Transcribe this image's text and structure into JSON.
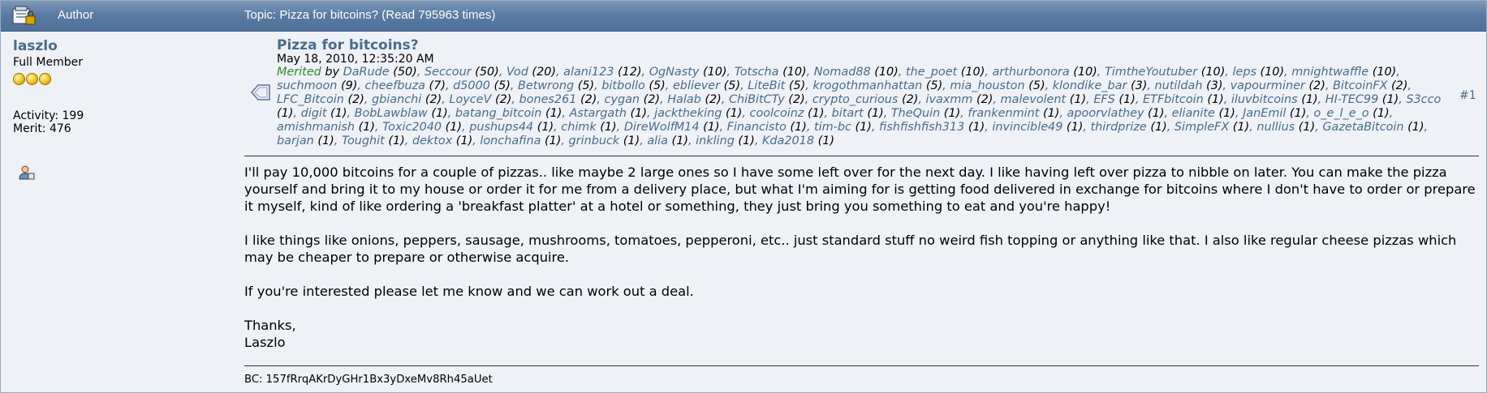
{
  "header": {
    "author_label": "Author",
    "topic_label": "Topic: Pizza for bitcoins?  (Read 795963 times)"
  },
  "poster": {
    "name": "laszlo",
    "rank": "Full Member",
    "star_count": 3,
    "activity": "Activity: 199",
    "merit": "Merit: 476"
  },
  "post": {
    "title": "Pizza for bitcoins?",
    "date": "May 18, 2010, 12:35:20 AM",
    "number": "#1",
    "merited_label": "Merited",
    "by_label": "by",
    "merits": [
      {
        "user": "DaRude",
        "count": "50"
      },
      {
        "user": "Seccour",
        "count": "50"
      },
      {
        "user": "Vod",
        "count": "20"
      },
      {
        "user": "alani123",
        "count": "12"
      },
      {
        "user": "OgNasty",
        "count": "10"
      },
      {
        "user": "Totscha",
        "count": "10"
      },
      {
        "user": "Nomad88",
        "count": "10"
      },
      {
        "user": "the_poet",
        "count": "10"
      },
      {
        "user": "arthurbonora",
        "count": "10"
      },
      {
        "user": "TimtheYoutuber",
        "count": "10"
      },
      {
        "user": "leps",
        "count": "10"
      },
      {
        "user": "mnightwaffle",
        "count": "10"
      },
      {
        "user": "suchmoon",
        "count": "9"
      },
      {
        "user": "cheefbuza",
        "count": "7"
      },
      {
        "user": "d5000",
        "count": "5"
      },
      {
        "user": "Betwrong",
        "count": "5"
      },
      {
        "user": "bitbollo",
        "count": "5"
      },
      {
        "user": "ebliever",
        "count": "5"
      },
      {
        "user": "LiteBit",
        "count": "5"
      },
      {
        "user": "krogothmanhattan",
        "count": "5"
      },
      {
        "user": "mia_houston",
        "count": "5"
      },
      {
        "user": "klondike_bar",
        "count": "3"
      },
      {
        "user": "nutildah",
        "count": "3"
      },
      {
        "user": "vapourminer",
        "count": "2"
      },
      {
        "user": "BitcoinFX",
        "count": "2"
      },
      {
        "user": "LFC_Bitcoin",
        "count": "2"
      },
      {
        "user": "gbianchi",
        "count": "2"
      },
      {
        "user": "LoyceV",
        "count": "2"
      },
      {
        "user": "bones261",
        "count": "2"
      },
      {
        "user": "cygan",
        "count": "2"
      },
      {
        "user": "Halab",
        "count": "2"
      },
      {
        "user": "ChiBitCTy",
        "count": "2"
      },
      {
        "user": "crypto_curious",
        "count": "2"
      },
      {
        "user": "ivaxmm",
        "count": "2"
      },
      {
        "user": "malevolent",
        "count": "1"
      },
      {
        "user": "EFS",
        "count": "1"
      },
      {
        "user": "ETFbitcoin",
        "count": "1"
      },
      {
        "user": "iluvbitcoins",
        "count": "1"
      },
      {
        "user": "HI-TEC99",
        "count": "1"
      },
      {
        "user": "S3cco",
        "count": "1"
      },
      {
        "user": "digit",
        "count": "1"
      },
      {
        "user": "BobLawblaw",
        "count": "1"
      },
      {
        "user": "batang_bitcoin",
        "count": "1"
      },
      {
        "user": "Astargath",
        "count": "1"
      },
      {
        "user": "jacktheking",
        "count": "1"
      },
      {
        "user": "coolcoinz",
        "count": "1"
      },
      {
        "user": "bitart",
        "count": "1"
      },
      {
        "user": "TheQuin",
        "count": "1"
      },
      {
        "user": "frankenmint",
        "count": "1"
      },
      {
        "user": "apoorvlathey",
        "count": "1"
      },
      {
        "user": "elianite",
        "count": "1"
      },
      {
        "user": "JanEmil",
        "count": "1"
      },
      {
        "user": "o_e_l_e_o",
        "count": "1"
      },
      {
        "user": "amishmanish",
        "count": "1"
      },
      {
        "user": "Toxic2040",
        "count": "1"
      },
      {
        "user": "pushups44",
        "count": "1"
      },
      {
        "user": "chimk",
        "count": "1"
      },
      {
        "user": "DireWolfM14",
        "count": "1"
      },
      {
        "user": "Financisto",
        "count": "1"
      },
      {
        "user": "tim-bc",
        "count": "1"
      },
      {
        "user": "fishfishfish313",
        "count": "1"
      },
      {
        "user": "invincible49",
        "count": "1"
      },
      {
        "user": "thirdprize",
        "count": "1"
      },
      {
        "user": "SimpleFX",
        "count": "1"
      },
      {
        "user": "nullius",
        "count": "1"
      },
      {
        "user": "GazetaBitcoin",
        "count": "1"
      },
      {
        "user": "barjan",
        "count": "1"
      },
      {
        "user": "Toughit",
        "count": "1"
      },
      {
        "user": "dektox",
        "count": "1"
      },
      {
        "user": "lonchafina",
        "count": "1"
      },
      {
        "user": "grinbuck",
        "count": "1"
      },
      {
        "user": "alia",
        "count": "1"
      },
      {
        "user": "inkling",
        "count": "1"
      },
      {
        "user": "Kda2018",
        "count": "1"
      }
    ],
    "body": [
      "I'll pay 10,000 bitcoins for a couple of pizzas.. like maybe 2 large ones so I have some left over for the next day.  I like having left over pizza to nibble on later.  You can make the pizza yourself and bring it to my house or order it for me from a delivery place, but what I'm aiming for is getting food delivered in exchange for bitcoins where I don't have to order or prepare it myself, kind of like ordering a 'breakfast platter' at a hotel or something, they just bring you something to eat and you're happy!",
      "I like things like onions, peppers, sausage, mushrooms, tomatoes, pepperoni, etc.. just standard stuff no weird fish topping or anything like that.  I also like regular cheese pizzas which may be cheaper to prepare or otherwise acquire.",
      "If you're interested please let me know and we can work out a deal.",
      "Thanks,\nLaszlo"
    ],
    "signature": "BC: 157fRrqAKrDyGHr1Bx3yDxeMv8Rh45aUet"
  }
}
